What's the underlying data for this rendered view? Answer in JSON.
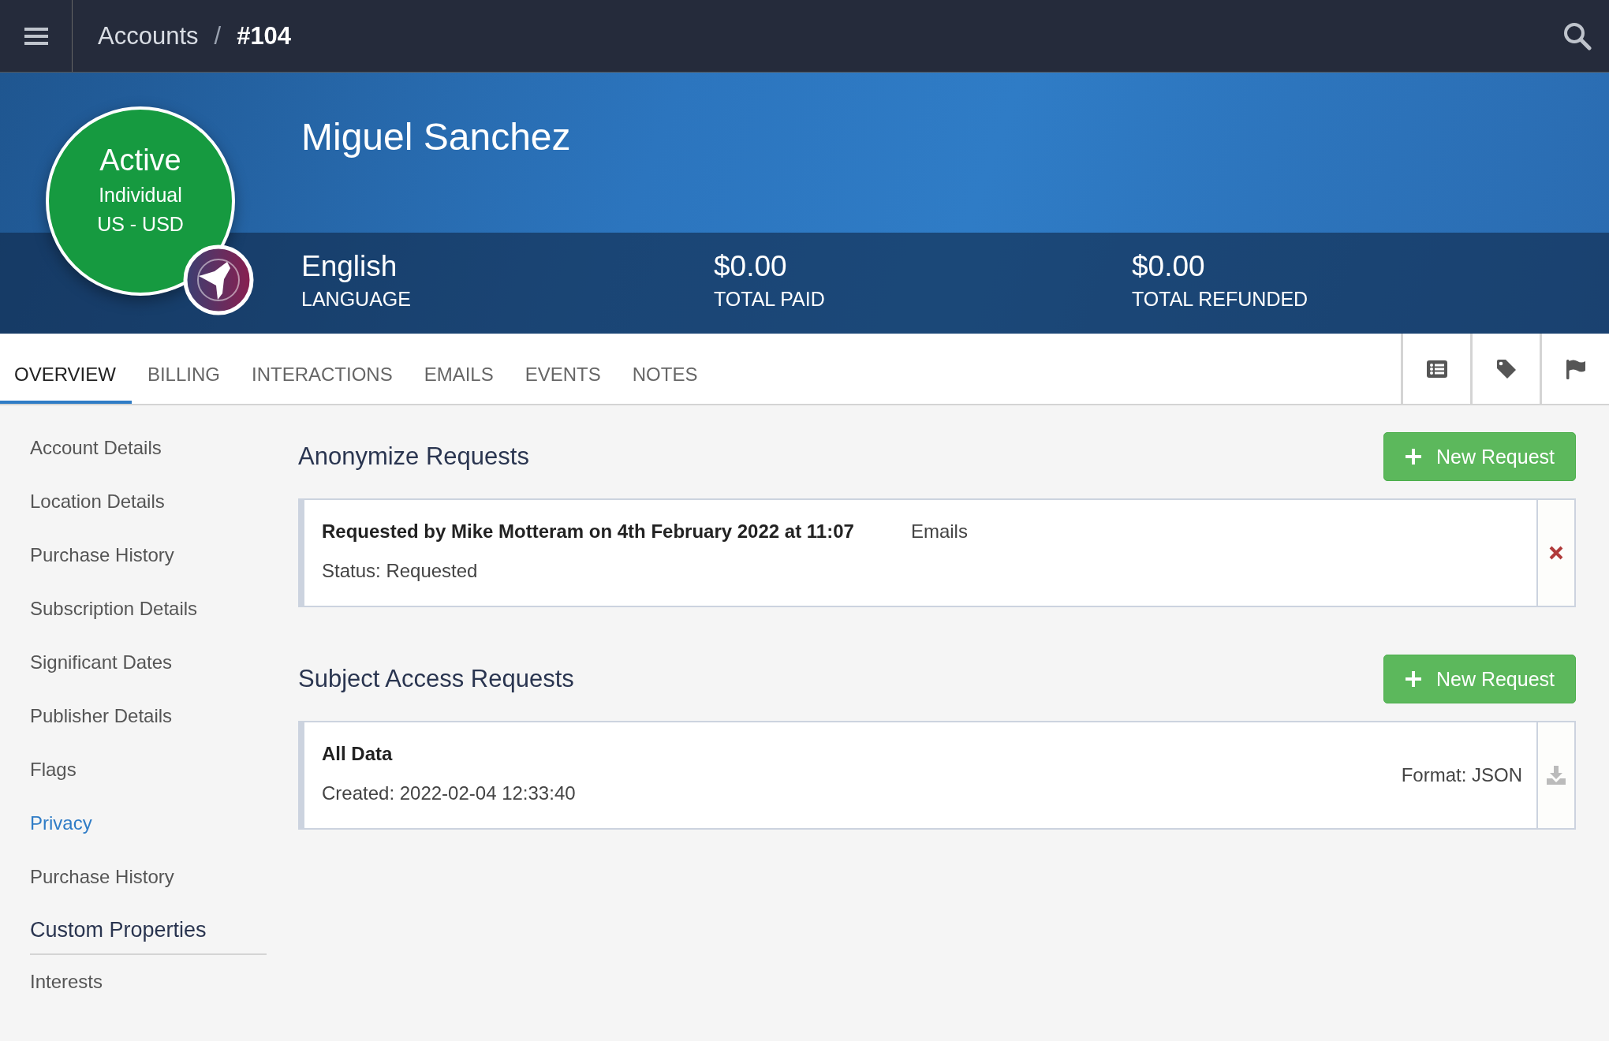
{
  "topbar": {
    "breadcrumb": {
      "parent": "Accounts",
      "separator": "/",
      "current": "#104"
    }
  },
  "profile": {
    "status": "Active",
    "type": "Individual",
    "region": "US - USD",
    "name": "Miguel Sanchez",
    "stats": [
      {
        "value": "English",
        "label": "LANGUAGE"
      },
      {
        "value": "$0.00",
        "label": "TOTAL PAID"
      },
      {
        "value": "$0.00",
        "label": "TOTAL REFUNDED"
      }
    ]
  },
  "tabs": [
    {
      "label": "OVERVIEW",
      "selected": true
    },
    {
      "label": "BILLING",
      "selected": false
    },
    {
      "label": "INTERACTIONS",
      "selected": false
    },
    {
      "label": "EMAILS",
      "selected": false
    },
    {
      "label": "EVENTS",
      "selected": false
    },
    {
      "label": "NOTES",
      "selected": false
    }
  ],
  "sidebar": {
    "items": [
      {
        "label": "Account Details",
        "selected": false
      },
      {
        "label": "Location Details",
        "selected": false
      },
      {
        "label": "Purchase History",
        "selected": false
      },
      {
        "label": "Subscription Details",
        "selected": false
      },
      {
        "label": "Significant Dates",
        "selected": false
      },
      {
        "label": "Publisher Details",
        "selected": false
      },
      {
        "label": "Flags",
        "selected": false
      },
      {
        "label": "Privacy",
        "selected": true
      },
      {
        "label": "Purchase History",
        "selected": false
      }
    ],
    "section_title": "Custom Properties",
    "section_items": [
      {
        "label": "Interests",
        "selected": false
      }
    ]
  },
  "sections": [
    {
      "title": "Anonymize Requests",
      "button": "New Request",
      "requests": [
        {
          "title": "Requested by Mike Motteram on 4th February 2022 at 11:07",
          "detail": "Emails",
          "subtitle": "Status: Requested",
          "action": {
            "kind": "delete"
          }
        }
      ]
    },
    {
      "title": "Subject Access Requests",
      "button": "New Request",
      "requests": [
        {
          "title": "All Data",
          "subtitle": "Created: 2022-02-04 12:33:40",
          "format": "Format: JSON",
          "action": {
            "kind": "download"
          }
        }
      ]
    }
  ]
}
